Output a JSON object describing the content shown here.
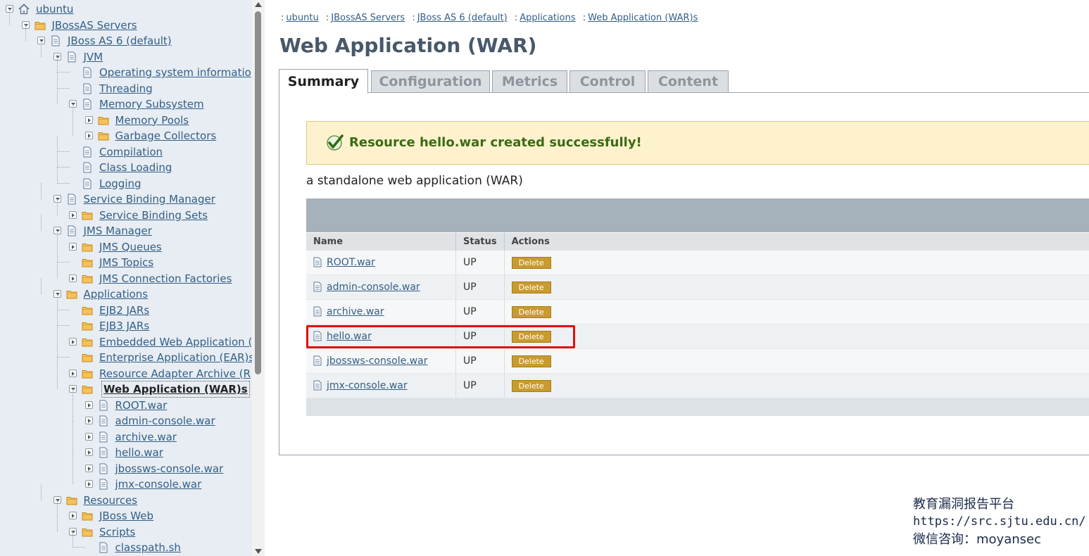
{
  "tree": {
    "items": [
      {
        "label": "ubuntu",
        "icon": "home-icon",
        "toggle": "open"
      },
      {
        "label": "JBossAS Servers",
        "icon": "folder-icon",
        "toggle": "open"
      },
      {
        "label": "JBoss AS 6 (default)",
        "icon": "document-icon",
        "toggle": "open"
      },
      {
        "label": "JVM",
        "icon": "document-icon",
        "toggle": "open"
      },
      {
        "label": "Operating system informatio",
        "icon": "document-icon",
        "toggle": ""
      },
      {
        "label": "Threading",
        "icon": "document-icon",
        "toggle": ""
      },
      {
        "label": "Memory Subsystem",
        "icon": "document-icon",
        "toggle": "open"
      },
      {
        "label": "Memory Pools",
        "icon": "folder-icon",
        "toggle": "closed"
      },
      {
        "label": "Garbage Collectors",
        "icon": "folder-icon",
        "toggle": "closed"
      },
      {
        "label": "Compilation",
        "icon": "document-icon",
        "toggle": ""
      },
      {
        "label": "Class Loading",
        "icon": "document-icon",
        "toggle": ""
      },
      {
        "label": "Logging",
        "icon": "document-icon",
        "toggle": ""
      },
      {
        "label": "Service Binding Manager",
        "icon": "document-icon",
        "toggle": "open"
      },
      {
        "label": "Service Binding Sets",
        "icon": "folder-icon",
        "toggle": "closed"
      },
      {
        "label": "JMS Manager",
        "icon": "document-icon",
        "toggle": "open"
      },
      {
        "label": "JMS Queues",
        "icon": "folder-icon",
        "toggle": "closed"
      },
      {
        "label": "JMS Topics",
        "icon": "folder-icon",
        "toggle": ""
      },
      {
        "label": "JMS Connection Factories",
        "icon": "folder-icon",
        "toggle": "closed"
      },
      {
        "label": "Applications",
        "icon": "folder-icon",
        "toggle": "open"
      },
      {
        "label": "EJB2 JARs",
        "icon": "folder-icon",
        "toggle": ""
      },
      {
        "label": "EJB3 JARs",
        "icon": "folder-icon",
        "toggle": ""
      },
      {
        "label": "Embedded Web Application (",
        "icon": "folder-icon",
        "toggle": "closed"
      },
      {
        "label": "Enterprise Application (EAR)s",
        "icon": "folder-icon",
        "toggle": ""
      },
      {
        "label": "Resource Adapter Archive (R",
        "icon": "folder-icon",
        "toggle": "closed"
      },
      {
        "label": "Web Application (WAR)s",
        "icon": "folder-icon",
        "toggle": "open",
        "current": true
      },
      {
        "label": "ROOT.war",
        "icon": "document-icon",
        "toggle": "closed"
      },
      {
        "label": "admin-console.war",
        "icon": "document-icon",
        "toggle": "closed"
      },
      {
        "label": "archive.war",
        "icon": "document-icon",
        "toggle": "closed"
      },
      {
        "label": "hello.war",
        "icon": "document-icon",
        "toggle": "closed"
      },
      {
        "label": "jbossws-console.war",
        "icon": "document-icon",
        "toggle": "closed"
      },
      {
        "label": "jmx-console.war",
        "icon": "document-icon",
        "toggle": "closed"
      },
      {
        "label": "Resources",
        "icon": "folder-icon",
        "toggle": "open"
      },
      {
        "label": "JBoss Web",
        "icon": "folder-icon",
        "toggle": "closed"
      },
      {
        "label": "Scripts",
        "icon": "folder-icon",
        "toggle": "open"
      },
      {
        "label": "classpath.sh",
        "icon": "document-icon",
        "toggle": ""
      }
    ]
  },
  "breadcrumb": {
    "sep": ":",
    "items": [
      "ubuntu",
      "JBossAS Servers",
      "JBoss AS 6 (default)",
      "Applications",
      "Web Application (WAR)s"
    ]
  },
  "page": {
    "title": "Web Application (WAR)"
  },
  "tabs": [
    {
      "label": "Summary",
      "active": true
    },
    {
      "label": "Configuration",
      "active": false
    },
    {
      "label": "Metrics",
      "active": false
    },
    {
      "label": "Control",
      "active": false
    },
    {
      "label": "Content",
      "active": false
    }
  ],
  "message": {
    "text": "Resource hello.war created successfully!",
    "icon": "check-icon"
  },
  "description": "a standalone web application (WAR)",
  "table": {
    "columns": [
      "Name",
      "Status",
      "Actions"
    ],
    "rows": [
      {
        "name": "ROOT.war",
        "status": "UP",
        "action": "Delete"
      },
      {
        "name": "admin-console.war",
        "status": "UP",
        "action": "Delete"
      },
      {
        "name": "archive.war",
        "status": "UP",
        "action": "Delete"
      },
      {
        "name": "hello.war",
        "status": "UP",
        "action": "Delete"
      },
      {
        "name": "jbossws-console.war",
        "status": "UP",
        "action": "Delete"
      },
      {
        "name": "jmx-console.war",
        "status": "UP",
        "action": "Delete"
      }
    ]
  },
  "watermark": {
    "line1": "教育漏洞报告平台",
    "line2": "https://src.sjtu.edu.cn/",
    "line3": "微信咨询：moyansec"
  },
  "colors": {
    "link": "#335e87",
    "title": "#48586a",
    "success_bg": "#fdf2cd",
    "success_text": "#3a6b15",
    "delete_btn": "#c99a2e",
    "highlight": "#e01010",
    "tree_bg": "#e7edf3"
  }
}
